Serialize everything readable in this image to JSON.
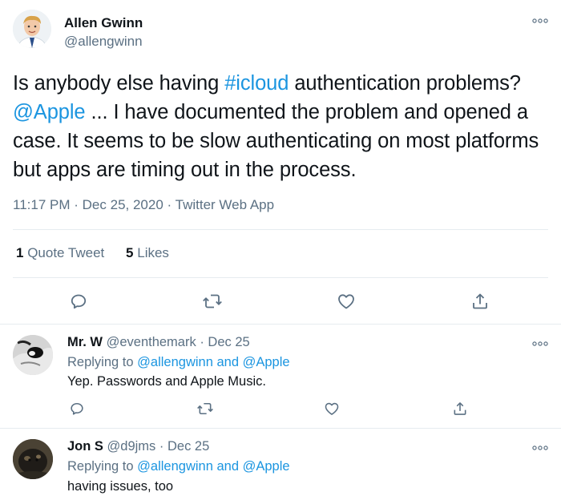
{
  "main_tweet": {
    "author_name": "Allen Gwinn",
    "author_handle": "@allengwinn",
    "text_parts": {
      "p1": "Is anybody else having ",
      "hashtag": "#icloud",
      "p2": " authentication problems? ",
      "mention": "@Apple",
      "p3": " ... I have documented the problem and opened a case. It seems to be slow authenticating on most platforms but apps are timing out in the process."
    },
    "time": "11:17 PM",
    "date": "Dec 25, 2020",
    "source": "Twitter Web App",
    "separator": "·",
    "quote_count": "1",
    "quote_label": "Quote Tweet",
    "like_count": "5",
    "like_label": "Likes"
  },
  "replies": [
    {
      "name": "Mr. W",
      "handle": "@eventhemark",
      "date": "Dec 25",
      "replying_prefix": "Replying to",
      "mention1": "@allengwinn",
      "and_word": "and",
      "mention2": "@Apple",
      "text": "Yep. Passwords and Apple Music."
    },
    {
      "name": "Jon S",
      "handle": "@d9jms",
      "date": "Dec 25",
      "replying_prefix": "Replying to",
      "mention1": "@allengwinn",
      "and_word": "and",
      "mention2": "@Apple",
      "text": "having issues, too"
    }
  ],
  "icons": {
    "more": "more-icon",
    "reply": "reply-icon",
    "retweet": "retweet-icon",
    "like": "like-icon",
    "share": "share-icon"
  },
  "colors": {
    "link": "#1b95e0",
    "muted": "#5b7083",
    "divider": "#e6ecf0",
    "text": "#0f1419"
  }
}
